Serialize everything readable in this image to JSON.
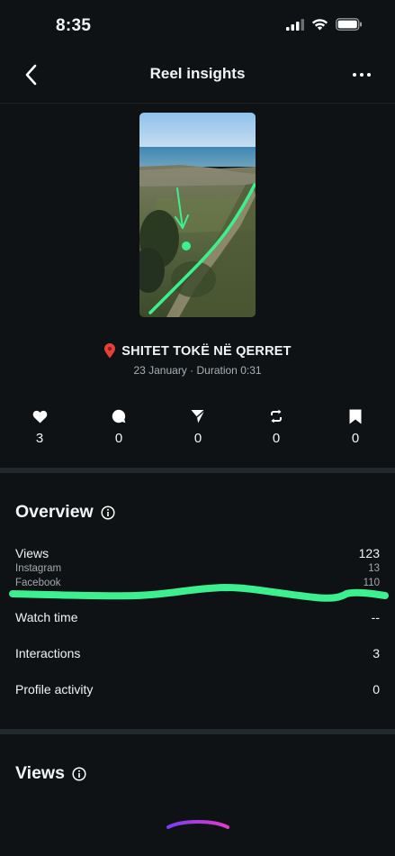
{
  "status_bar": {
    "time": "8:35"
  },
  "header": {
    "title": "Reel insights"
  },
  "post": {
    "location": "SHITET TOKË NË QERRET",
    "date": "23 January",
    "separator": "·",
    "duration": "Duration 0:31"
  },
  "metrics": [
    {
      "name": "likes",
      "icon": "heart-icon",
      "value": "3"
    },
    {
      "name": "comments",
      "icon": "comment-icon",
      "value": "0"
    },
    {
      "name": "shares",
      "icon": "send-icon",
      "value": "0"
    },
    {
      "name": "reposts",
      "icon": "repost-icon",
      "value": "0"
    },
    {
      "name": "saves",
      "icon": "bookmark-icon",
      "value": "0"
    }
  ],
  "overview": {
    "title": "Overview",
    "views": {
      "label": "Views",
      "value": "123"
    },
    "instagram": {
      "label": "Instagram",
      "value": "13"
    },
    "facebook": {
      "label": "Facebook",
      "value": "110"
    },
    "watch_time": {
      "label": "Watch time",
      "value": "--"
    },
    "interactions": {
      "label": "Interactions",
      "value": "3"
    },
    "profile_activity": {
      "label": "Profile activity",
      "value": "0"
    }
  },
  "views_section": {
    "title": "Views"
  },
  "colors": {
    "background": "#0e1214",
    "highlight": "#3cf08f",
    "chart_gradient_start": "#7b3cf5",
    "chart_gradient_end": "#e23cc8"
  }
}
